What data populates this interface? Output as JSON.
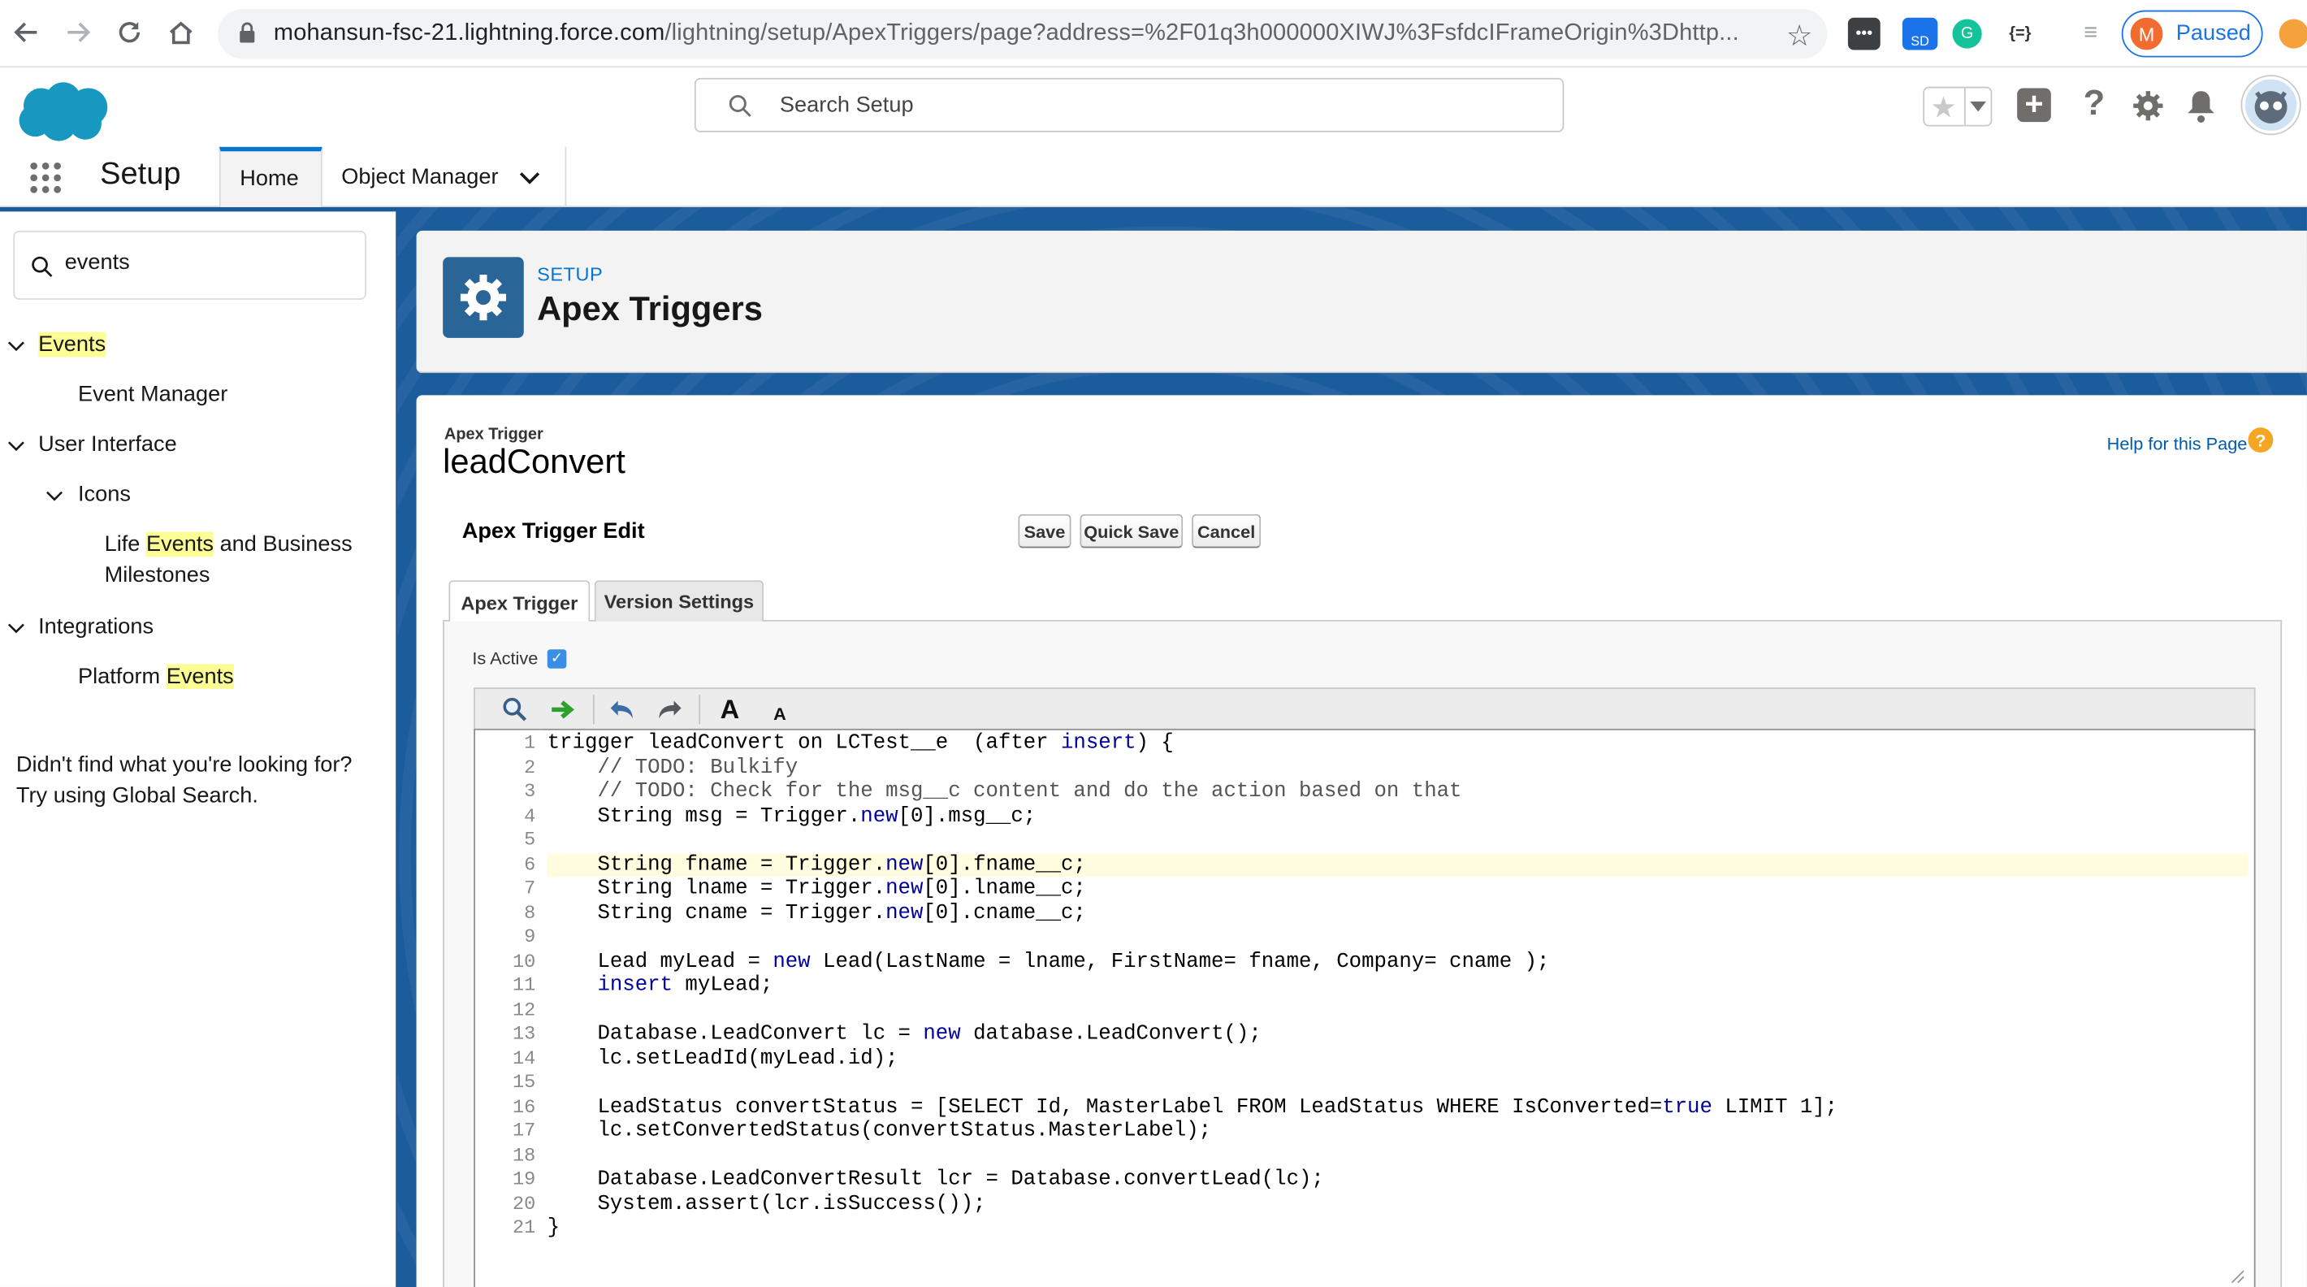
{
  "browser": {
    "url_host": "mohansun-fsc-21.lightning.force.com",
    "url_path": "/lightning/setup/ApexTriggers/page?address=%2F01q3h000000XIWJ%3FsfdcIFrameOrigin%3Dhttp...",
    "profile_initial": "M",
    "profile_status": "Paused",
    "ext_sd_label": "SD",
    "ext_json_label": "{=}"
  },
  "header": {
    "search_placeholder": "Search Setup"
  },
  "nav": {
    "app_name": "Setup",
    "tabs": [
      {
        "label": "Home"
      },
      {
        "label": "Object Manager"
      }
    ]
  },
  "sidebar": {
    "quickfind_value": "events",
    "items": [
      {
        "label": "Events"
      },
      {
        "label": "Event Manager"
      },
      {
        "label": "User Interface"
      },
      {
        "label": "Icons"
      },
      {
        "label_prefix": "Life ",
        "label_hl": "Events",
        "label_suffix": " and Business",
        "label_line2": "Milestones"
      },
      {
        "label": "Integrations"
      },
      {
        "label_prefix": "Platform ",
        "label_hl": "Events"
      }
    ],
    "not_found_line1": "Didn't find what you're looking for?",
    "not_found_line2": "Try using Global Search."
  },
  "page_header": {
    "breadcrumb": "SETUP",
    "title": "Apex Triggers"
  },
  "record": {
    "type_label": "Apex Trigger",
    "name": "leadConvert",
    "help_link": "Help for this Page",
    "help_icon": "?",
    "section_title": "Apex Trigger Edit",
    "buttons": {
      "save": "Save",
      "quick_save": "Quick Save",
      "cancel": "Cancel"
    },
    "tabs": [
      {
        "label": "Apex Trigger"
      },
      {
        "label": "Version Settings"
      }
    ],
    "is_active_label": "Is Active",
    "is_active": true,
    "toolbar": {
      "font_large": "A",
      "font_small": "A"
    },
    "code_lines": [
      "trigger leadConvert on LCTest__e  (after insert) {",
      "    // TODO: Bulkify",
      "    // TODO: Check for the msg__c content and do the action based on that",
      "    String msg = Trigger.new[0].msg__c;",
      "",
      "    String fname = Trigger.new[0].fname__c;",
      "    String lname = Trigger.new[0].lname__c;",
      "    String cname = Trigger.new[0].cname__c;",
      "",
      "    Lead myLead = new Lead(LastName = lname, FirstName= fname, Company= cname );",
      "    insert myLead;",
      "",
      "    Database.LeadConvert lc = new database.LeadConvert();",
      "    lc.setLeadId(myLead.id);",
      "",
      "    LeadStatus convertStatus = [SELECT Id, MasterLabel FROM LeadStatus WHERE IsConverted=true LIMIT 1];",
      "    lc.setConvertedStatus(convertStatus.MasterLabel);",
      "",
      "    Database.LeadConvertResult lcr = Database.convertLead(lc);",
      "    System.assert(lcr.isSuccess());",
      "}"
    ],
    "line_numbers": [
      "1",
      "2",
      "3",
      "4",
      "5",
      "6",
      "7",
      "8",
      "9",
      "10",
      "11",
      "12",
      "13",
      "14",
      "15",
      "16",
      "17",
      "18",
      "19",
      "20",
      "21"
    ]
  },
  "colors": {
    "brand_blue": "#0176d3",
    "setup_background": "#1b5c9c",
    "search_highlight": "#fdfd96",
    "keyword": "#00009c"
  }
}
